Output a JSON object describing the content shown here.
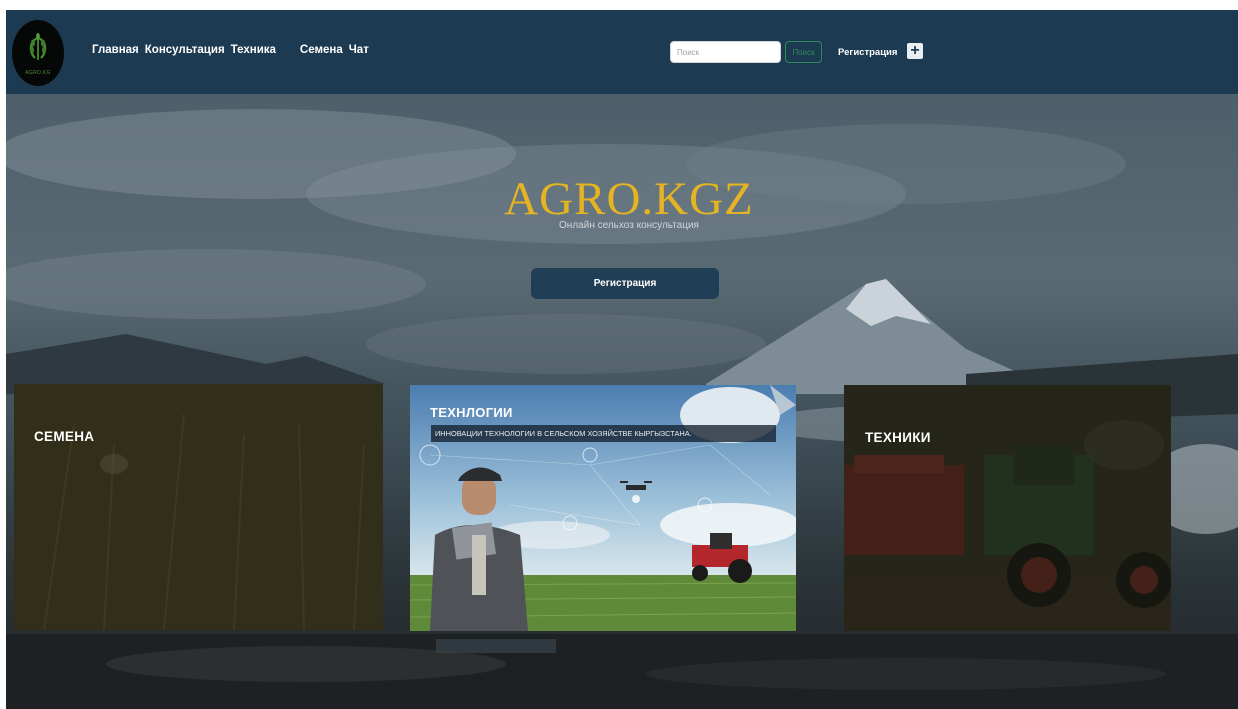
{
  "navbar": {
    "logo_text": "AGRO.KG",
    "links": [
      "Главная",
      "Консультация",
      "Техника",
      "Семена",
      "Чат"
    ],
    "search_placeholder": "Поиск",
    "search_button": "Поиск",
    "register_label": "Регистрация",
    "plus_label": "+"
  },
  "hero": {
    "title": "AGRO.KGZ",
    "subtitle": "Онлайн сельхоз консультация",
    "register_button": "Регистрация"
  },
  "cards": {
    "seeds": {
      "title": "СЕМЕНА"
    },
    "tech": {
      "title": "ТЕХНЛОГИИ",
      "caption": "ИННОВАЦИИ ТЕХНОЛОГИИ В СЕЛЬСКОМ ХОЗЯЙСТВЕ КЫРГЫЗСТАНА."
    },
    "machines": {
      "title": "ТЕХНИКИ"
    }
  },
  "colors": {
    "navbar_bg": "#1c3a52",
    "brand_gold": "#e6b422",
    "button_bg": "#203e56",
    "search_btn_green": "#2e8b57"
  }
}
